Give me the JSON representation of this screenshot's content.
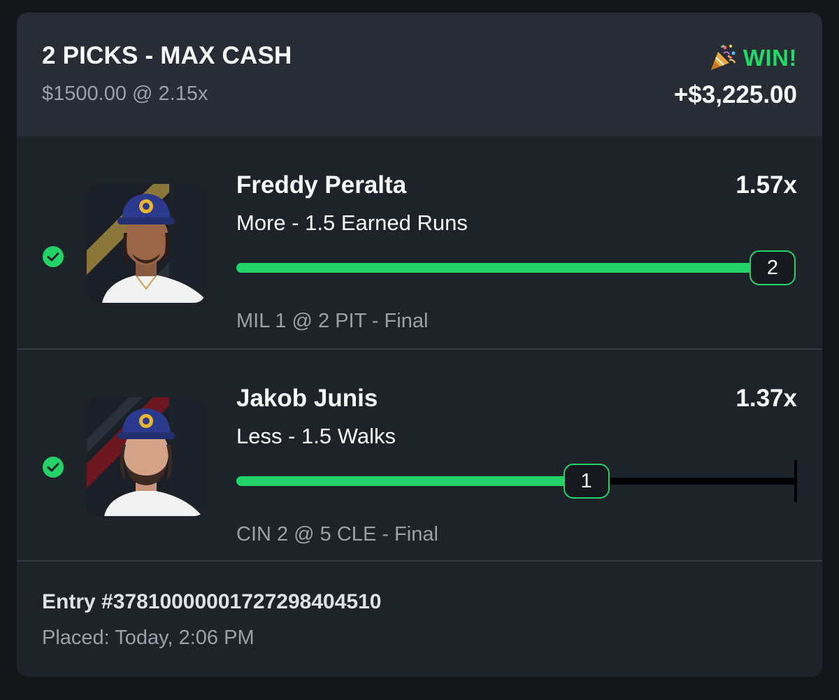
{
  "header": {
    "title": "2 PICKS - MAX CASH",
    "subtitle": "$1500.00 @ 2.15x",
    "result_label": "WIN!",
    "payout": "+$3,225.00",
    "result_icon": "party-popper-icon",
    "accent_color": "#1fdc67"
  },
  "picks": [
    {
      "player": "Freddy Peralta",
      "multiplier": "1.57x",
      "line": "More - 1.5 Earned Runs",
      "actual": "2",
      "progress": 1.0,
      "game": "MIL 1 @ 2 PIT",
      "status": "- Final",
      "status_icon": "check-circle-icon"
    },
    {
      "player": "Jakob Junis",
      "multiplier": "1.37x",
      "line": "Less - 1.5 Walks",
      "actual": "1",
      "progress": 0.667,
      "game": "CIN 2 @ 5 CLE",
      "status": "- Final",
      "status_icon": "check-circle-icon"
    }
  ],
  "footer": {
    "entry": "Entry #37810000001727298404510",
    "placed": "Placed: Today, 2:06 PM"
  }
}
